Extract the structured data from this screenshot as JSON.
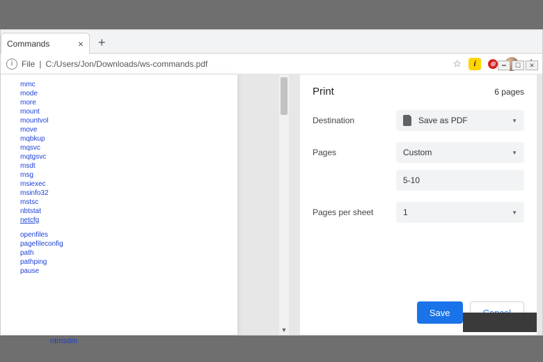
{
  "tab": {
    "title": "Commands"
  },
  "address": {
    "file_label": "File",
    "url": "C:/Users/Jon/Downloads/ws-commands.pdf"
  },
  "preview": {
    "commands": [
      {
        "t": "mmc",
        "u": false
      },
      {
        "t": "mode",
        "u": false
      },
      {
        "t": "more",
        "u": false
      },
      {
        "t": "mount",
        "u": false
      },
      {
        "t": "mountvol",
        "u": false
      },
      {
        "t": "move",
        "u": false
      },
      {
        "t": "mqbkup",
        "u": false
      },
      {
        "t": "mqsvc",
        "u": false
      },
      {
        "t": "mqtgsvc",
        "u": false
      },
      {
        "t": "msdt",
        "u": false
      },
      {
        "t": "msg",
        "u": false
      },
      {
        "t": "msiexec",
        "u": false
      },
      {
        "t": "msinfo32",
        "u": false
      },
      {
        "t": "mstsc",
        "u": false
      },
      {
        "t": "nbtstat",
        "u": false
      },
      {
        "t": "netcfg",
        "u": true
      },
      {
        "gap": true
      },
      {
        "t": "openfiles",
        "u": false
      },
      {
        "t": "pagefileconfig",
        "u": false
      },
      {
        "t": "path",
        "u": false
      },
      {
        "t": "pathping",
        "u": false
      },
      {
        "t": "pause",
        "u": false
      }
    ],
    "bottom_word": "ntmsdm"
  },
  "print": {
    "title": "Print",
    "page_count": "6 pages",
    "destination_label": "Destination",
    "destination_value": "Save as PDF",
    "pages_label": "Pages",
    "pages_mode": "Custom",
    "pages_value": "5-10",
    "pps_label": "Pages per sheet",
    "pps_value": "1",
    "save": "Save",
    "cancel": "Cancel"
  }
}
